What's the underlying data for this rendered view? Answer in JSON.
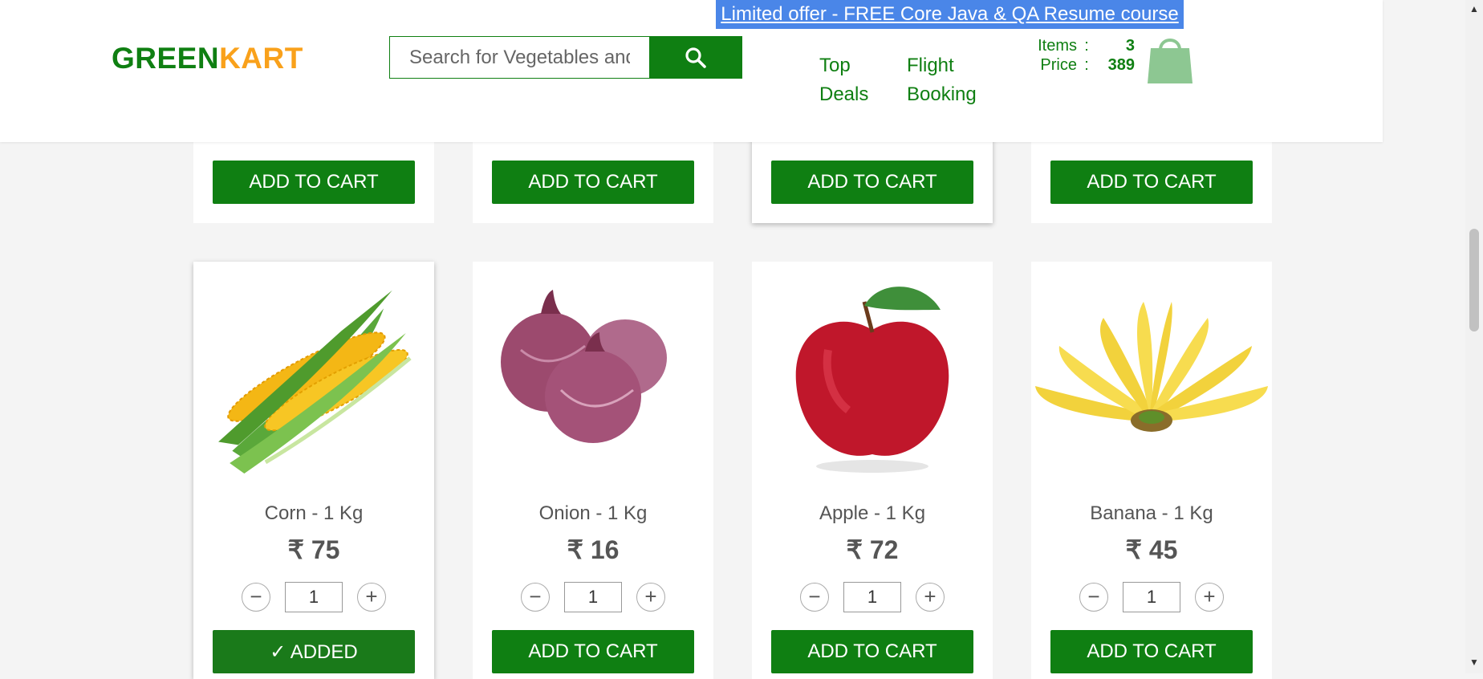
{
  "header": {
    "promo_text": "Limited offer - FREE Core Java & QA Resume course",
    "brand_green": "GREEN",
    "brand_orange": "KART",
    "search_placeholder": "Search for Vegetables and Fruits",
    "nav": [
      {
        "line1": "Top",
        "line2": "Deals"
      },
      {
        "line1": "Flight",
        "line2": "Booking"
      }
    ],
    "cart": {
      "items_label": "Items",
      "items_value": "3",
      "price_label": "Price",
      "price_value": "389",
      "separator": ":"
    }
  },
  "top_row_button_label": "ADD TO CART",
  "products": [
    {
      "name": "Corn - 1 Kg",
      "price": "₹ 75",
      "qty": "1",
      "button": "✓ ADDED"
    },
    {
      "name": "Onion - 1 Kg",
      "price": "₹ 16",
      "qty": "1",
      "button": "ADD TO CART"
    },
    {
      "name": "Apple - 1 Kg",
      "price": "₹ 72",
      "qty": "1",
      "button": "ADD TO CART"
    },
    {
      "name": "Banana - 1 Kg",
      "price": "₹ 45",
      "qty": "1",
      "button": "ADD TO CART"
    }
  ],
  "stepper": {
    "minus": "−",
    "plus": "+"
  },
  "colors": {
    "brand_green": "#0f7f12",
    "brand_orange": "#f9a11b",
    "promo_blue": "#4a86e8"
  }
}
